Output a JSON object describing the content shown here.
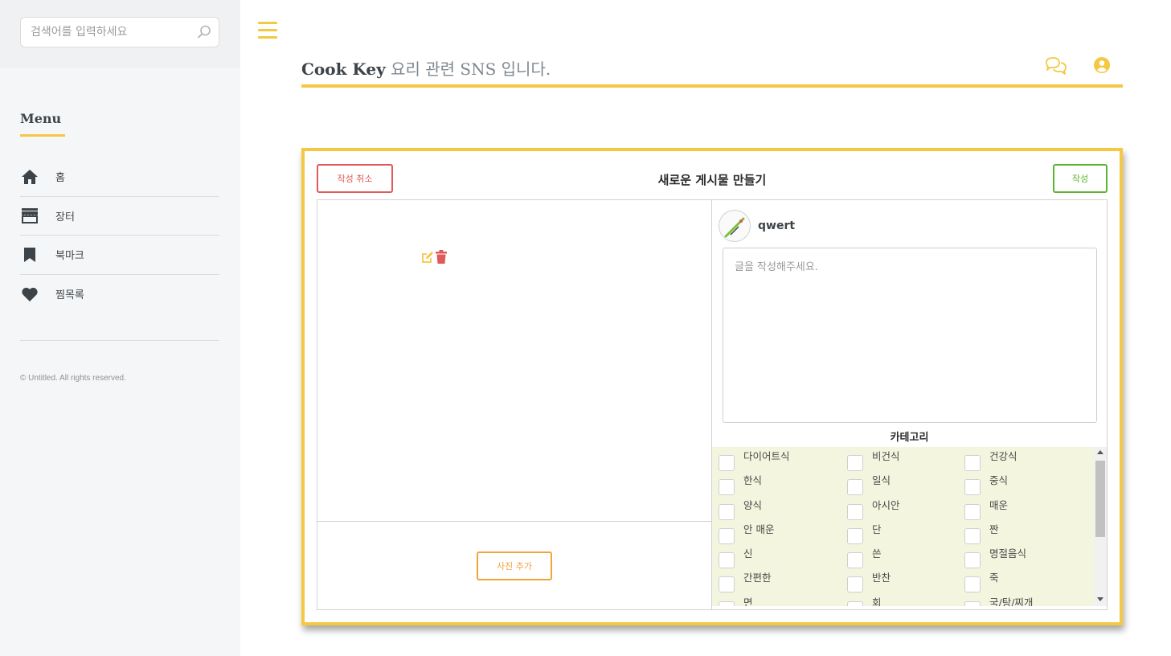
{
  "sidebar": {
    "search": {
      "placeholder": "검색어를 입력하세요"
    },
    "menu_heading": "Menu",
    "items": [
      {
        "label": "홈",
        "icon": "home-icon"
      },
      {
        "label": "장터",
        "icon": "store-icon"
      },
      {
        "label": "북마크",
        "icon": "bookmark-icon"
      },
      {
        "label": "찜목록",
        "icon": "heart-icon"
      }
    ],
    "copyright": "© Untitled. All rights reserved."
  },
  "header": {
    "brand_name": "Cook Key",
    "brand_tagline": "요리 관련 SNS 입니다.",
    "icons": [
      "chat-icon",
      "user-icon"
    ]
  },
  "post_form": {
    "title": "새로운 게시물 만들기",
    "cancel_label": "작성 취소",
    "submit_label": "작성",
    "add_photo_label": "사진 추가",
    "username": "qwert",
    "text_placeholder": "글을 작성해주세요.",
    "category_title": "카테고리",
    "categories": [
      [
        "다이어트식",
        "비건식",
        "건강식"
      ],
      [
        "한식",
        "일식",
        "중식"
      ],
      [
        "양식",
        "아시안",
        "매운"
      ],
      [
        "안 매운",
        "단",
        "짠"
      ],
      [
        "신",
        "쓴",
        "명절음식"
      ],
      [
        "간편한",
        "반찬",
        "죽"
      ],
      [
        "면",
        "회",
        "국/탕/찌개"
      ]
    ]
  },
  "colors": {
    "accent": "#f5c842",
    "cancel": "#e05a5a",
    "submit": "#5cb531",
    "add_photo": "#f0a43a",
    "category_bg": "#f3f5de"
  }
}
